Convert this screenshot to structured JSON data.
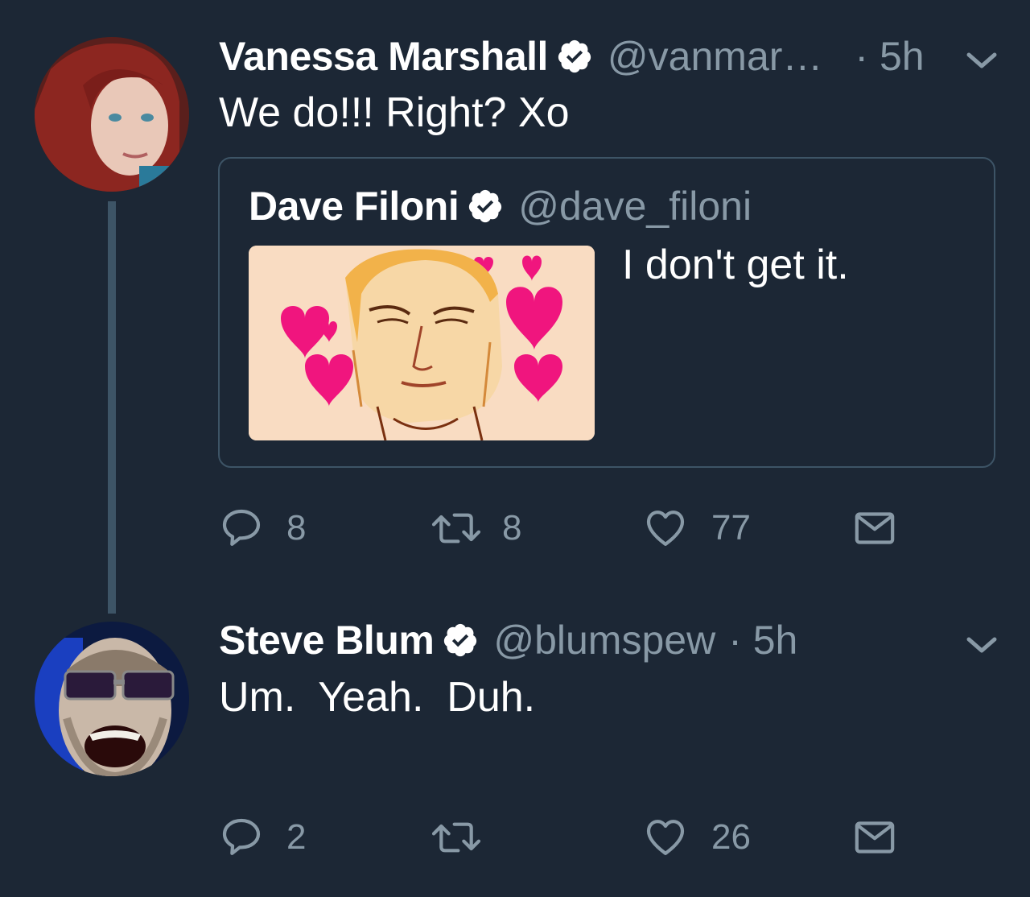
{
  "tweets": [
    {
      "name": "Vanessa Marshall",
      "handle": "@vanmar…",
      "time": "· 5h",
      "text": "We do!!! Right? Xo",
      "quote": {
        "name": "Dave Filoni",
        "handle": "@dave_filoni",
        "text": "I don't get it."
      },
      "actions": {
        "replies": "8",
        "retweets": "8",
        "likes": "77"
      }
    },
    {
      "name": "Steve Blum",
      "handle": "@blumspew",
      "time": "· 5h",
      "text": "Um.  Yeah.  Duh.",
      "actions": {
        "replies": "2",
        "retweets": "",
        "likes": "26"
      }
    }
  ],
  "colors": {
    "background": "#1c2735",
    "muted": "#8899a6",
    "border": "#3d5466",
    "text": "#ffffff"
  },
  "icons": {
    "verified": "verified-badge-icon",
    "reply": "reply-icon",
    "retweet": "retweet-icon",
    "like": "heart-icon",
    "dm": "envelope-icon",
    "menu": "chevron-down-icon"
  }
}
